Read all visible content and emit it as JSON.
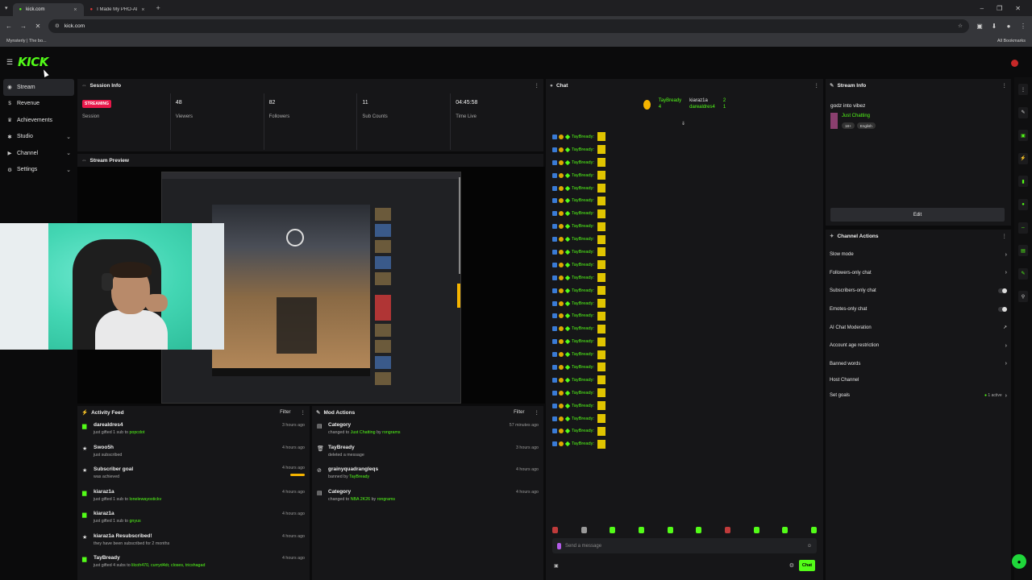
{
  "browser": {
    "tabs": [
      {
        "title": "kick.com",
        "active": true
      },
      {
        "title": "I Made My PRO-AM DEBU",
        "active": false
      }
    ],
    "url": "kick.com",
    "bookmark": "Mynsterly | The bo...",
    "all_bookmarks": "All Bookmarks"
  },
  "app": {
    "logo": "KICK",
    "sidebar": [
      {
        "label": "Stream",
        "icon": "stream-icon",
        "active": true,
        "expand": false
      },
      {
        "label": "Revenue",
        "icon": "dollar-icon",
        "active": false,
        "expand": false
      },
      {
        "label": "Achievements",
        "icon": "trophy-icon",
        "active": false,
        "expand": false
      },
      {
        "label": "Studio",
        "icon": "studio-icon",
        "active": false,
        "expand": true
      },
      {
        "label": "Channel",
        "icon": "channel-icon",
        "active": false,
        "expand": true
      },
      {
        "label": "Settings",
        "icon": "gear-icon",
        "active": false,
        "expand": true
      }
    ]
  },
  "session": {
    "title": "Session Info",
    "status_badge": "STREAMING",
    "stats": [
      {
        "value": "",
        "label": "Session"
      },
      {
        "value": "48",
        "label": "Viewers"
      },
      {
        "value": "82",
        "label": "Followers"
      },
      {
        "value": "11",
        "label": "Sub Counts"
      },
      {
        "value": "04:45:58",
        "label": "Time Live"
      }
    ]
  },
  "preview": {
    "title": "Stream Preview"
  },
  "activity": {
    "title": "Activity Feed",
    "filter": "Filter",
    "items": [
      {
        "icon": "gift-icon",
        "title": "darealdres4",
        "pre": "just gifted 1 sub to ",
        "hl": "popcdot",
        "post": "",
        "time": "3 hours ago"
      },
      {
        "icon": "star-icon",
        "title": "Swoo5h",
        "pre": "just subscribed",
        "hl": "",
        "post": "",
        "time": "4 hours ago"
      },
      {
        "icon": "star-icon",
        "title": "Subscriber goal",
        "pre": "was achieved",
        "hl": "",
        "post": "",
        "time": "4 hours ago"
      },
      {
        "icon": "gift-icon",
        "title": "kiaraz1a",
        "pre": "just gifted 1 sub to ",
        "hl": "lonelewayostickv",
        "post": "",
        "time": "4 hours ago"
      },
      {
        "icon": "gift-icon",
        "title": "kiaraz1a",
        "pre": "just gifted 1 sub to ",
        "hl": "gnyus",
        "post": "",
        "time": "4 hours ago"
      },
      {
        "icon": "star-icon",
        "title": "kiaraz1a Resubscribed!",
        "pre": "they have been subscribed for 2 months",
        "hl": "",
        "post": "",
        "time": "4 hours ago"
      },
      {
        "icon": "gift-icon",
        "title": "TayBready",
        "pre": "just gifted 4 subs to ",
        "hl": "lilcoh470, curryd4dr, closes, tricshagad",
        "post": "",
        "time": "4 hours ago"
      }
    ]
  },
  "mod": {
    "title": "Mod Actions",
    "filter": "Filter",
    "items": [
      {
        "icon": "category-icon",
        "title": "Category",
        "pre": "changed to ",
        "hl": "Just Chatting",
        "post": " by ",
        "hl2": "rongrams",
        "time": "57 minutes ago"
      },
      {
        "icon": "trash-icon",
        "title": "TayBready",
        "pre": "deleted a message",
        "hl": "",
        "post": "",
        "hl2": "",
        "time": "3 hours ago"
      },
      {
        "icon": "ban-icon",
        "title": "grainyquadrangleqs",
        "pre": "banned by ",
        "hl": "TayBready",
        "post": "",
        "hl2": "",
        "time": "4 hours ago"
      },
      {
        "icon": "category-icon",
        "title": "Category",
        "pre": "changed to ",
        "hl": "NBA 2K26",
        "post": " by ",
        "hl2": "rongrams",
        "time": "4 hours ago"
      }
    ]
  },
  "chat": {
    "title": "Chat",
    "leaderboard": [
      {
        "name": "TayBready",
        "count": "4"
      },
      {
        "name": "kiaraz1a",
        "count": "2"
      },
      {
        "name": "darealdres4",
        "count": "1"
      }
    ],
    "line_name": "TayBready:",
    "line_count": 25,
    "placeholder": "Send a message",
    "send": "Chat"
  },
  "stream_info": {
    "title": "Stream Info",
    "stream_title": "godz into vibez",
    "category": "Just Chatting",
    "tags": [
      "18+",
      "English"
    ],
    "edit": "Edit"
  },
  "channel_actions": {
    "title": "Channel Actions",
    "items": [
      {
        "label": "Slow mode",
        "control": "chevron"
      },
      {
        "label": "Followers-only chat",
        "control": "chevron"
      },
      {
        "label": "Subscribers-only chat",
        "control": "toggle"
      },
      {
        "label": "Emotes-only chat",
        "control": "toggle"
      },
      {
        "label": "AI Chat Moderation",
        "control": "external"
      },
      {
        "label": "Account age restriction",
        "control": "chevron"
      },
      {
        "label": "Banned words",
        "control": "chevron"
      },
      {
        "label": "Host Channel",
        "control": "none"
      },
      {
        "label": "Set goals",
        "control": "active",
        "extra": "1 active"
      }
    ]
  },
  "colors": {
    "accent": "#53fc18",
    "live": "#e8184a",
    "panel": "#161618"
  }
}
